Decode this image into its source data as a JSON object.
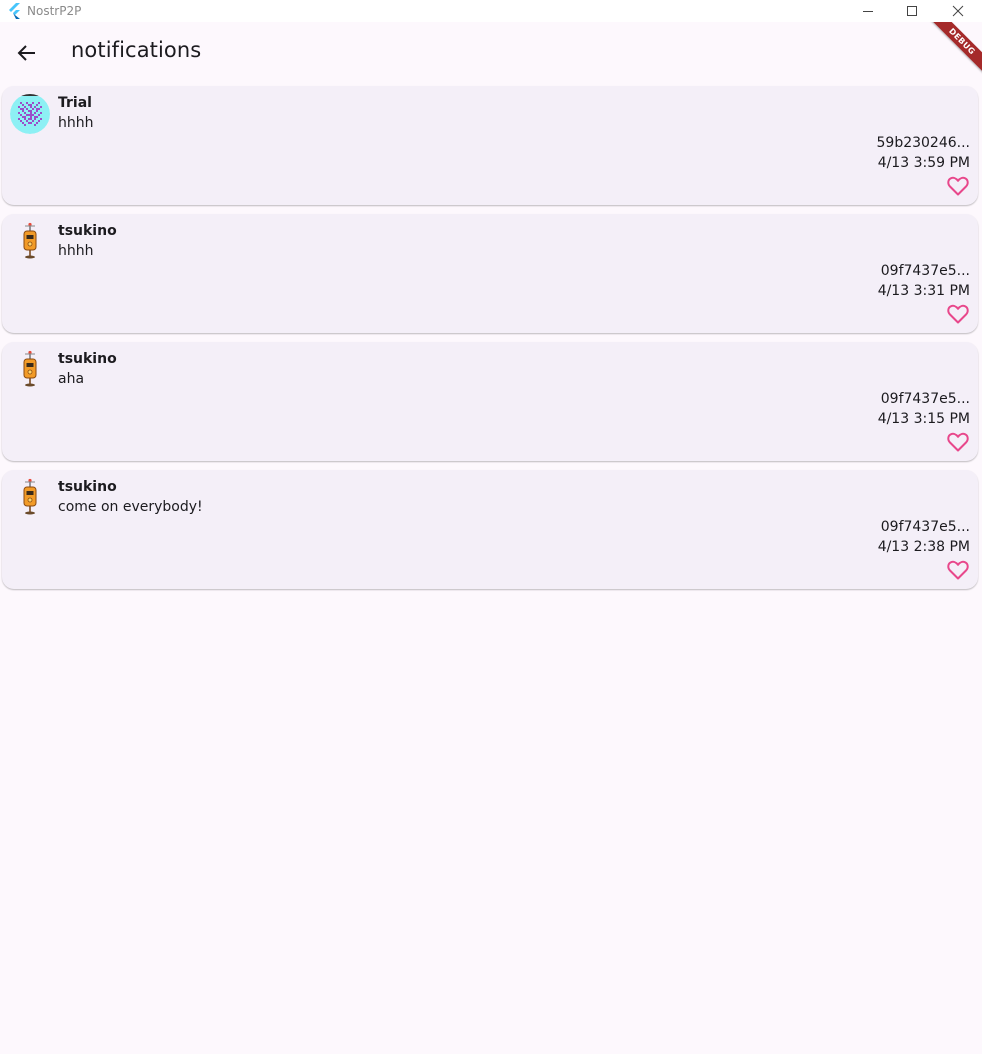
{
  "window": {
    "title": "NostrP2P",
    "logo_icon": "flutter-logo-icon",
    "controls": [
      "minimize-icon",
      "maximize-icon",
      "close-icon"
    ]
  },
  "appbar": {
    "back_icon": "arrow-back-icon",
    "title": "notifications"
  },
  "debug_banner": "DEBUG",
  "colors": {
    "background": "#fdf8fd",
    "card": "#f4eff8",
    "heart": "#e8478b",
    "debug": "#a52a2a"
  },
  "notifications": [
    {
      "name": "Trial",
      "content": "hhhh",
      "pubkey": "59b230246...",
      "time": "4/13 3:59 PM",
      "avatar": "identicon-avatar",
      "like_icon": "heart-outline-icon"
    },
    {
      "name": "tsukino",
      "content": "hhhh",
      "pubkey": "09f7437e5...",
      "time": "4/13 3:31 PM",
      "avatar": "robot-avatar",
      "like_icon": "heart-outline-icon"
    },
    {
      "name": "tsukino",
      "content": "aha",
      "pubkey": "09f7437e5...",
      "time": "4/13 3:15 PM",
      "avatar": "robot-avatar",
      "like_icon": "heart-outline-icon"
    },
    {
      "name": "tsukino",
      "content": "come on everybody!",
      "pubkey": "09f7437e5...",
      "time": "4/13 2:38 PM",
      "avatar": "robot-avatar",
      "like_icon": "heart-outline-icon"
    }
  ]
}
